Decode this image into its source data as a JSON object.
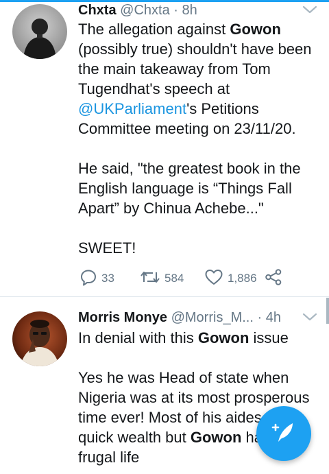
{
  "colors": {
    "accent": "#1da1f2",
    "link": "#1b95e0",
    "secondary_text": "#657786"
  },
  "tweets": [
    {
      "name": "Chxta",
      "handle": "@Chxta",
      "dot": "·",
      "time": "8h",
      "avatar_icon": "user-avatar-photo",
      "lines": [
        {
          "parts": [
            {
              "text": "The allegation against "
            },
            {
              "text": "Gowon",
              "style": "bold"
            }
          ]
        },
        {
          "parts": [
            {
              "text": "(possibly true) shouldn't have been"
            }
          ]
        },
        {
          "parts": [
            {
              "text": "the main takeaway from Tom"
            }
          ]
        },
        {
          "parts": [
            {
              "text": "Tugendhat's speech at"
            }
          ]
        },
        {
          "parts": [
            {
              "text": "@UKParliament",
              "style": "link"
            },
            {
              "text": "'s Petitions"
            }
          ]
        },
        {
          "parts": [
            {
              "text": "Committee meeting on 23/11/20."
            }
          ]
        },
        {
          "parts": [
            {
              "text": ""
            }
          ]
        },
        {
          "parts": [
            {
              "text": "He said, \"the greatest book in the"
            }
          ]
        },
        {
          "parts": [
            {
              "text": "English language is “Things Fall"
            }
          ]
        },
        {
          "parts": [
            {
              "text": "Apart” by Chinua Achebe...\""
            }
          ]
        },
        {
          "parts": [
            {
              "text": ""
            }
          ]
        },
        {
          "parts": [
            {
              "text": "SWEET!"
            }
          ]
        }
      ],
      "actions": {
        "reply_count": "33",
        "retweet_count": "584",
        "like_count": "1,886",
        "reply_icon": "reply-icon",
        "retweet_icon": "retweet-icon",
        "like_icon": "heart-icon",
        "share_icon": "share-icon"
      }
    },
    {
      "name": "Morris Monye",
      "handle": "@Morris_M...",
      "dot": "·",
      "time": "4h",
      "avatar_icon": "user-avatar-photo",
      "lines": [
        {
          "parts": [
            {
              "text": "In denial with this "
            },
            {
              "text": "Gowon",
              "style": "bold"
            },
            {
              "text": " issue"
            }
          ]
        },
        {
          "parts": [
            {
              "text": ""
            }
          ]
        },
        {
          "parts": [
            {
              "text": "Yes he was Head of state when"
            }
          ]
        },
        {
          "parts": [
            {
              "text": "Nigeria was at its most prosperous"
            }
          ]
        },
        {
          "parts": [
            {
              "text": "time ever! Most of his aides"
            }
          ]
        },
        {
          "parts": [
            {
              "text": "quick wealth but "
            },
            {
              "text": "Gowon",
              "style": "bold"
            },
            {
              "text": " ha"
            }
          ]
        },
        {
          "parts": [
            {
              "text": "frugal life"
            }
          ]
        }
      ]
    }
  ],
  "compose_button": {
    "icon": "compose-feather-icon"
  }
}
